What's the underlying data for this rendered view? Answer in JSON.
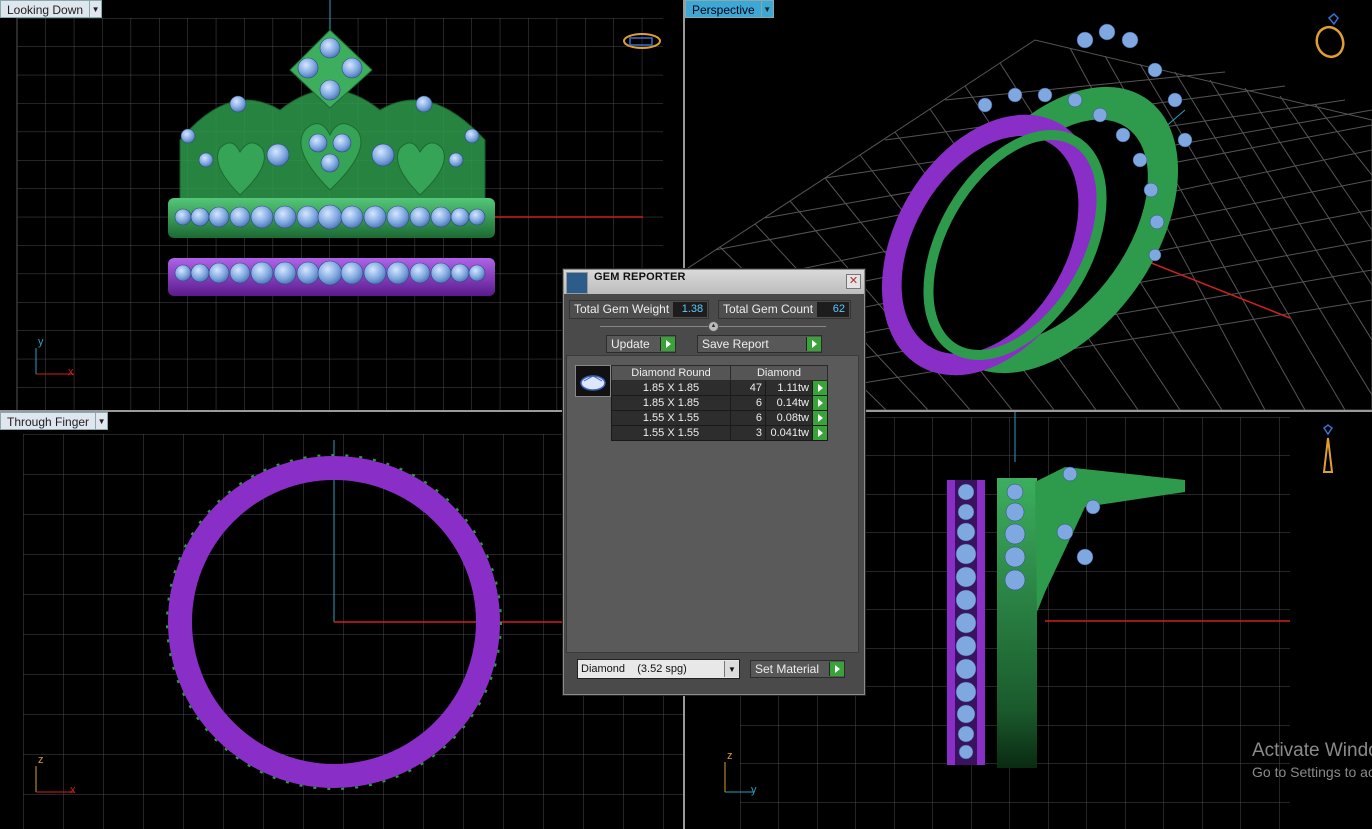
{
  "viewports": {
    "top_left": {
      "label": "Looking Down",
      "axes": {
        "a": "y",
        "b": "x"
      }
    },
    "top_right": {
      "label": "Perspective"
    },
    "bottom_left": {
      "label": "Through Finger",
      "axes": {
        "a": "z",
        "b": "x"
      }
    },
    "bottom_right": {
      "axes": {
        "a": "z",
        "b": "y"
      }
    }
  },
  "dialog": {
    "title": "GEM REPORTER",
    "total_weight_label": "Total Gem Weight",
    "total_weight_value": "1.38",
    "total_count_label": "Total Gem Count",
    "total_count_value": "62",
    "update_label": "Update",
    "save_label": "Save Report",
    "table": {
      "header_shape": "Diamond Round",
      "header_material": "Diamond",
      "rows": [
        {
          "size": "1.85 X 1.85",
          "count": "47",
          "weight": "1.11tw"
        },
        {
          "size": "1.85 X 1.85",
          "count": "6",
          "weight": "0.14tw"
        },
        {
          "size": "1.55 X 1.55",
          "count": "6",
          "weight": "0.08tw"
        },
        {
          "size": "1.55 X 1.55",
          "count": "3",
          "weight": "0.041tw"
        }
      ]
    },
    "material_value": "Diamond    (3.52 spg)",
    "set_material_label": "Set Material"
  },
  "watermark": {
    "line1": "Activate Windows",
    "line2": "Go to Settings to activate Windows."
  },
  "colors": {
    "grid": "#4a4a4a",
    "axis_red": "#d02020",
    "axis_blue": "#2aa0c0",
    "metal": "#2e9a4c",
    "band": "#8a2ec8",
    "gem": "#7fa8e0",
    "active_tab": "#3da7d6"
  }
}
